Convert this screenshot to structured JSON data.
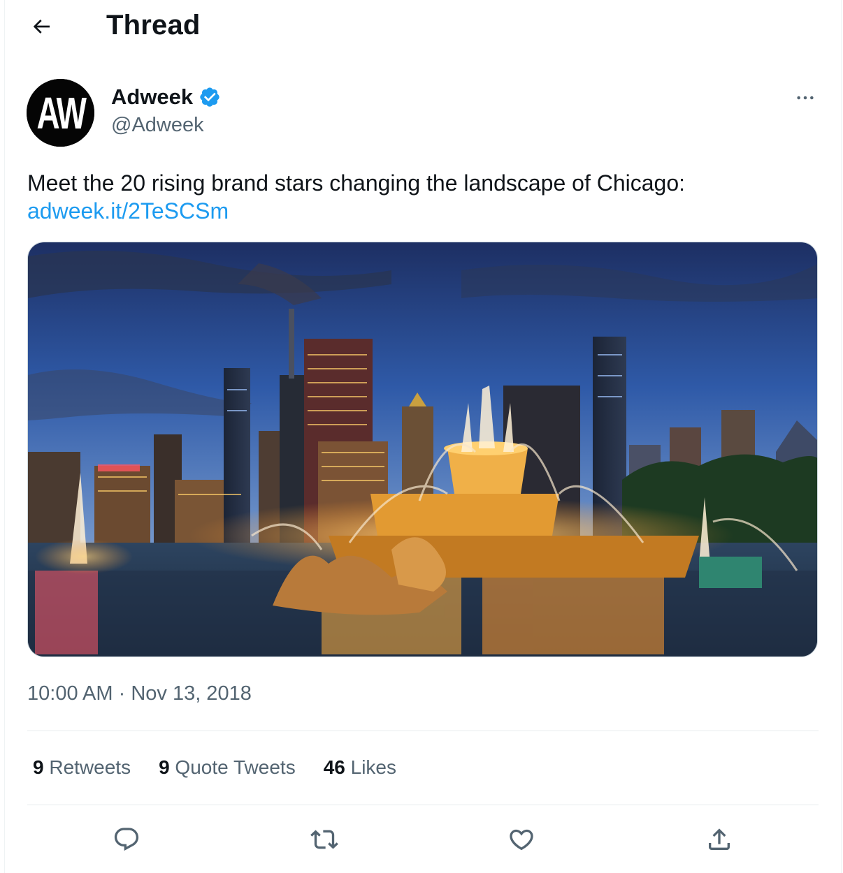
{
  "header": {
    "title": "Thread",
    "back_icon": "arrow-left-icon"
  },
  "author": {
    "name": "Adweek",
    "handle": "@Adweek",
    "avatar_text": "AW",
    "verified_icon": "verified-badge-icon",
    "verified_color": "#1d9bf0"
  },
  "more_icon": "more-horizontal-icon",
  "tweet": {
    "text": "Meet the 20 rising brand stars changing the landscape of Chicago:",
    "link": "adweek.it/2TeSCSm",
    "timestamp_time": "10:00 AM",
    "timestamp_sep": " · ",
    "timestamp_date": "Nov 13, 2018"
  },
  "stats": {
    "retweets_count": "9",
    "retweets_label": " Retweets",
    "quotes_count": "9",
    "quotes_label": " Quote Tweets",
    "likes_count": "46",
    "likes_label": " Likes"
  },
  "actions": [
    "reply-icon",
    "retweet-icon",
    "like-icon",
    "share-icon"
  ],
  "colors": {
    "accent": "#1d9bf0",
    "secondary_text": "#536471",
    "primary_text": "#0f1419",
    "border": "#e7ecee"
  }
}
